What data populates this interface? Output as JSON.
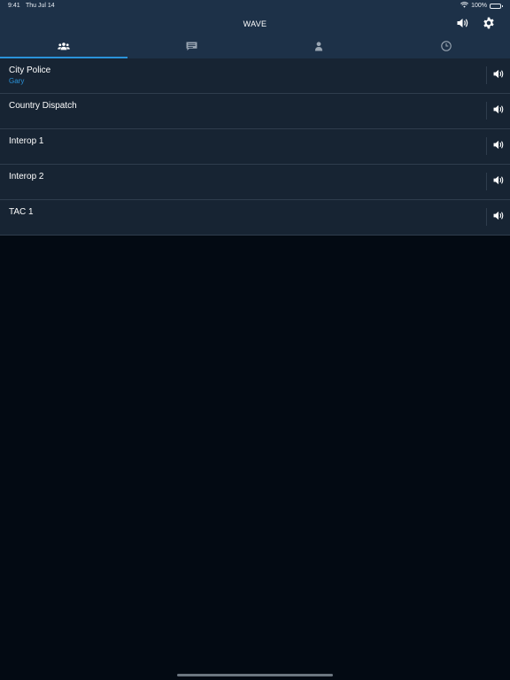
{
  "status": {
    "time": "9:41",
    "date": "Thu Jul 14",
    "battery": "100%"
  },
  "header": {
    "title": "WAVE",
    "icons": [
      "volume-icon",
      "gear-icon"
    ]
  },
  "tabs": [
    {
      "icon": "group-icon",
      "active": true
    },
    {
      "icon": "message-icon",
      "active": false
    },
    {
      "icon": "person-icon",
      "active": false
    },
    {
      "icon": "clock-icon",
      "active": false
    }
  ],
  "channels": [
    {
      "name": "City Police",
      "subtitle": "Gary"
    },
    {
      "name": "Country Dispatch"
    },
    {
      "name": "Interop 1"
    },
    {
      "name": "Interop 2"
    },
    {
      "name": "TAC 1"
    }
  ],
  "colors": {
    "header_bg": "#1d3148",
    "row_bg": "#172433",
    "accent": "#2a93d9",
    "page_bg": "#030a13"
  }
}
